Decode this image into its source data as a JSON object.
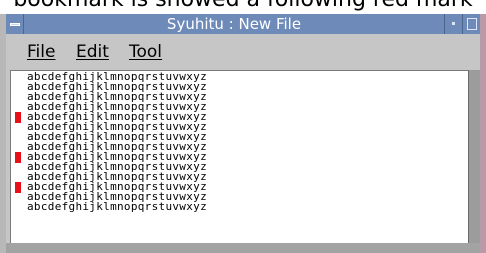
{
  "caption": "bookmark is showed a following red mark",
  "window": {
    "title": "Syuhitu : New File"
  },
  "menu": {
    "file": "File",
    "edit": "Edit",
    "tool": "Tool"
  },
  "editor": {
    "lines": [
      "abcdefghijklmnopqrstuvwxyz",
      "abcdefghijklmnopqrstuvwxyz",
      "abcdefghijklmnopqrstuvwxyz",
      "abcdefghijklmnopqrstuvwxyz",
      "abcdefghijklmnopqrstuvwxyz",
      "abcdefghijklmnopqrstuvwxyz",
      "abcdefghijklmnopqrstuvwxyz",
      "abcdefghijklmnopqrstuvwxyz",
      "abcdefghijklmnopqrstuvwxyz",
      "abcdefghijklmnopqrstuvwxyz",
      "abcdefghijklmnopqrstuvwxyz",
      "abcdefghijklmnopqrstuvwxyz",
      "abcdefghijklmnopqrstuvwxyz",
      "abcdefghijklmnopqrstuvwxyz"
    ],
    "bookmarked_line_numbers": [
      5,
      9,
      12
    ],
    "bookmark_color": "#e8111a"
  },
  "colors": {
    "titlebar": "#6d8ab8",
    "window_bg": "#c6c6c6"
  }
}
